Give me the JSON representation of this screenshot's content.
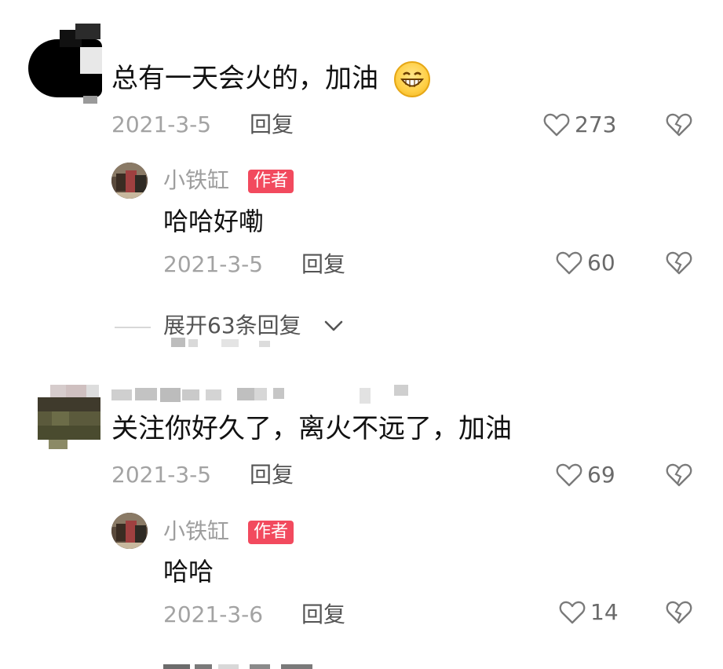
{
  "comments": [
    {
      "text": "总有一天会火的，加油",
      "date": "2021-3-5",
      "reply_label": "回复",
      "likes": "273",
      "emoji_icon": "grinning-face-icon",
      "reply": {
        "author": "小铁缸",
        "badge": "作者",
        "text": "哈哈好嘞",
        "date": "2021-3-5",
        "reply_label": "回复",
        "likes": "60"
      },
      "expand_label": "展开63条回复"
    },
    {
      "text": "关注你好久了，离火不远了，加油",
      "date": "2021-3-5",
      "reply_label": "回复",
      "likes": "69",
      "reply": {
        "author": "小铁缸",
        "badge": "作者",
        "text": "哈哈",
        "date": "2021-3-6",
        "reply_label": "回复",
        "likes": "14"
      }
    }
  ],
  "colors": {
    "badge": "#f24a5e",
    "meta_gray": "#a3a3a3",
    "name_gray": "#9e9e9e"
  },
  "icons": {
    "like": "heart-outline-icon",
    "dislike": "broken-heart-icon",
    "expand": "chevron-down-icon"
  }
}
